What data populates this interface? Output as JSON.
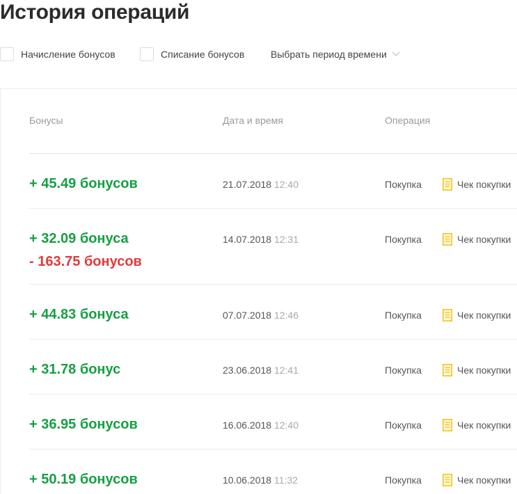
{
  "page": {
    "title": "История операций"
  },
  "filters": {
    "accrual_label": "Начисление бонусов",
    "writeoff_label": "Списание бонусов",
    "period_label": "Выбрать период времени"
  },
  "table": {
    "headers": {
      "bonuses": "Бонусы",
      "datetime": "Дата и время",
      "operation": "Операция"
    },
    "rows": [
      {
        "bonus": "+ 45.49 бонусов",
        "date": "21.07.2018",
        "time": "12:40",
        "operation": "Покупка",
        "receipt": "Чек покупки"
      },
      {
        "bonus": "+ 32.09 бонуса",
        "bonus_minus": "- 163.75 бонусов",
        "date": "14.07.2018",
        "time": "12:31",
        "operation": "Покупка",
        "receipt": "Чек покупки"
      },
      {
        "bonus": "+ 44.83 бонуса",
        "date": "07.07.2018",
        "time": "12:46",
        "operation": "Покупка",
        "receipt": "Чек покупки"
      },
      {
        "bonus": "+ 31.78 бонус",
        "date": "23.06.2018",
        "time": "12:41",
        "operation": "Покупка",
        "receipt": "Чек покупки"
      },
      {
        "bonus": "+ 36.95 бонусов",
        "date": "16.06.2018",
        "time": "12:40",
        "operation": "Покупка",
        "receipt": "Чек покупки"
      },
      {
        "bonus": "+ 50.19 бонусов",
        "date": "10.06.2018",
        "time": "11:32",
        "operation": "Покупка",
        "receipt": "Чек покупки"
      }
    ]
  },
  "icons": {
    "receipt": "receipt-icon",
    "chevron": "chevron-down-icon"
  },
  "colors": {
    "accrual": "#169f42",
    "writeoff": "#e23a3a",
    "receipt_icon": "#f2c21b"
  }
}
